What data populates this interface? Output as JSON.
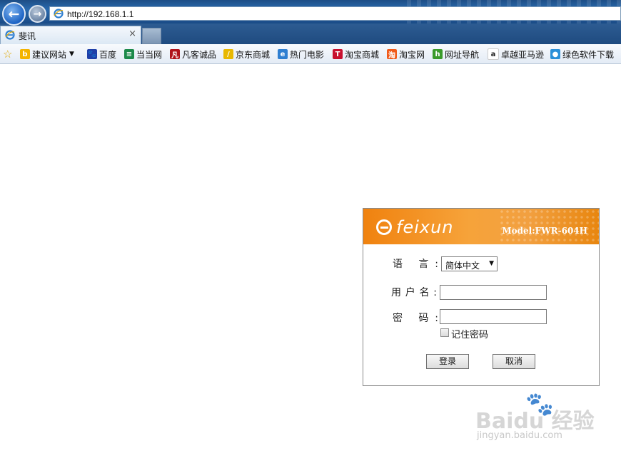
{
  "browser": {
    "url": "http://192.168.1.1",
    "tab_title": "斐讯",
    "tab_close": "×",
    "back_glyph": "←",
    "forward_glyph": "→"
  },
  "favorites": [
    {
      "label": "建议网站",
      "icon": "bing-icon",
      "color": "#f4b400",
      "glyph": "b",
      "dropdown": true
    },
    {
      "label": "百度",
      "icon": "baidu-paw-icon",
      "color": "#1f3fa8",
      "glyph": "🐾"
    },
    {
      "label": "当当网",
      "icon": "dangdang-icon",
      "color": "#1d8a4a",
      "glyph": "≡"
    },
    {
      "label": "凡客诚品",
      "icon": "vancl-icon",
      "color": "#b0121b",
      "glyph": "凡"
    },
    {
      "label": "京东商城",
      "icon": "jd-icon",
      "color": "#e8b800",
      "glyph": "/"
    },
    {
      "label": "热门电影",
      "icon": "ie-icon",
      "color": "#2f7fd1",
      "glyph": "e"
    },
    {
      "label": "淘宝商城",
      "icon": "tmall-icon",
      "color": "#c8102e",
      "glyph": "T"
    },
    {
      "label": "淘宝网",
      "icon": "taobao-icon",
      "color": "#f05a1a",
      "glyph": "淘"
    },
    {
      "label": "网址导航",
      "icon": "hao-icon",
      "color": "#3a9a2a",
      "glyph": "h"
    },
    {
      "label": "卓越亚马逊",
      "icon": "amazon-icon",
      "color": "#ffffff",
      "glyph": "a"
    },
    {
      "label": "绿色软件下载",
      "icon": "green-software-icon",
      "color": "#2a8fd8",
      "glyph": "●"
    }
  ],
  "login": {
    "brand": "feixun",
    "model": "Model:FWR-604H",
    "language_label": "语 言:",
    "language_value": "简体中文",
    "username_label": "用户名:",
    "username_value": "",
    "password_label": "密 码:",
    "password_value": "",
    "remember_label": "记住密码",
    "login_button": "登录",
    "cancel_button": "取消"
  },
  "watermark": {
    "logo_text": "Baidu 经验",
    "url": "jingyan.baidu.com"
  }
}
